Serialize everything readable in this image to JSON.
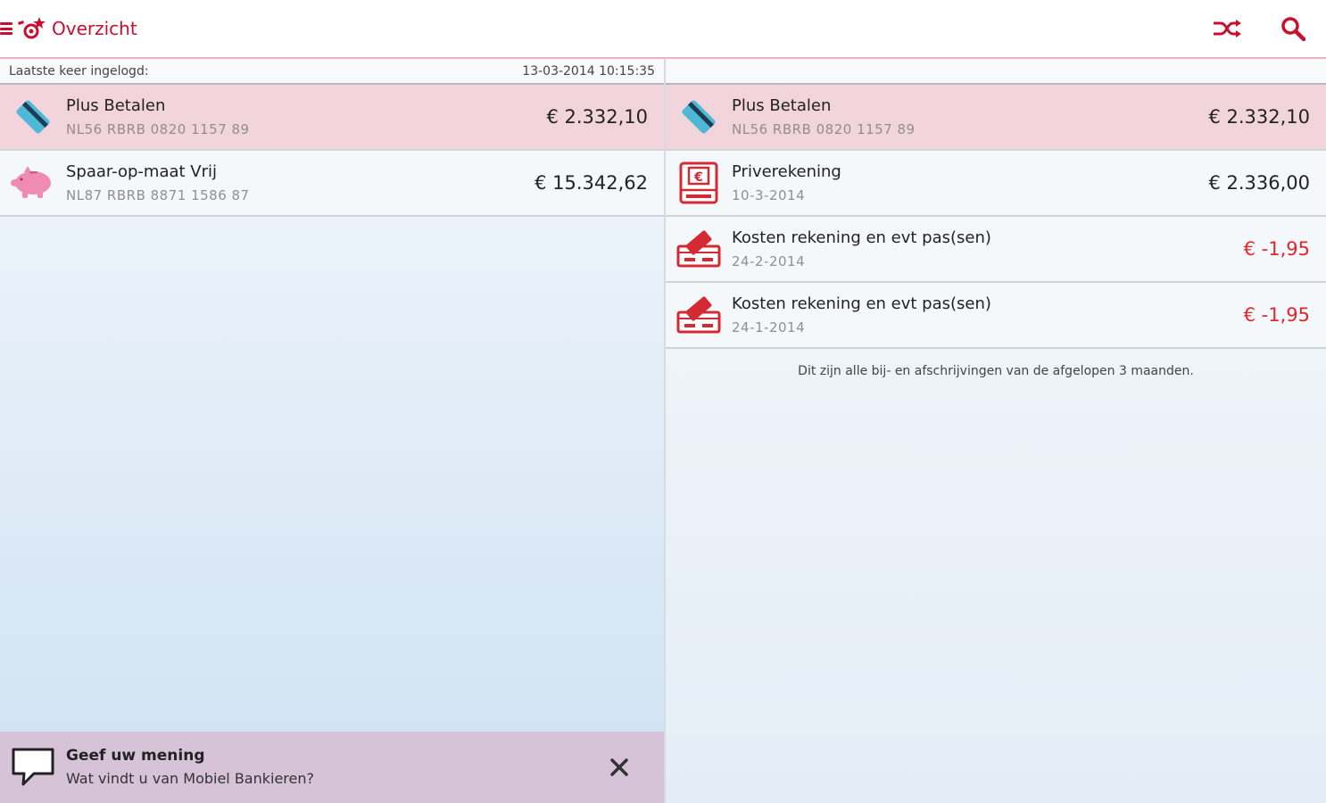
{
  "actionbar": {
    "title": "Overzicht",
    "icons": {
      "menu": "menu-icon",
      "logo": "rabo-logo-icon",
      "switch": "shuffle-icon",
      "search": "search-icon"
    },
    "accent_color": "#c8102e"
  },
  "left": {
    "login_label": "Laatste keer ingelogd:",
    "login_time": "13-03-2014 10:15:35",
    "accounts": [
      {
        "name": "Plus Betalen",
        "iban": "NL56 RBRB 0820 1157 89",
        "amount": "€ 2.332,10",
        "icon": "bank-card-icon",
        "selected": true
      },
      {
        "name": "Spaar-op-maat Vrij",
        "iban": "NL87 RBRB 8871 1586 87",
        "amount": "€ 15.342,62",
        "icon": "piggy-bank-icon",
        "selected": false
      }
    ],
    "feedback": {
      "title": "Geef uw mening",
      "subtitle": "Wat vindt u van Mobiel Bankieren?",
      "icon": "speech-bubble-icon"
    }
  },
  "right": {
    "account": {
      "name": "Plus Betalen",
      "iban": "NL56 RBRB 0820 1157 89",
      "amount": "€ 2.332,10",
      "icon": "bank-card-icon"
    },
    "transactions": [
      {
        "name": "Priverekening",
        "date": "10-3-2014",
        "amount": "€ 2.336,00",
        "type": "credit",
        "icon": "euro-transfer-icon"
      },
      {
        "name": "Kosten rekening en evt pas(sen)",
        "date": "24-2-2014",
        "amount": "€ -1,95",
        "type": "debit",
        "icon": "card-debit-icon"
      },
      {
        "name": "Kosten rekening en evt pas(sen)",
        "date": "24-1-2014",
        "amount": "€ -1,95",
        "type": "debit",
        "icon": "card-debit-icon"
      }
    ],
    "note": "Dit zijn alle bij- en afschrijvingen van de afgelopen 3 maanden."
  },
  "colors": {
    "selected_row": "#f2d4dc",
    "negative_amount": "#e0262b",
    "feedback_bg": "#d7c3d8"
  }
}
